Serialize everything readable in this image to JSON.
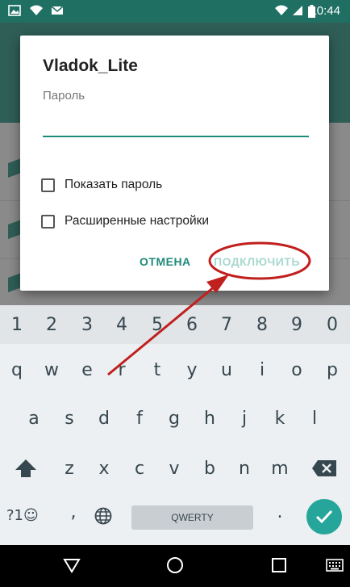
{
  "status_bar": {
    "time": "10:44"
  },
  "dialog": {
    "title": "Vladok_Lite",
    "password_label": "Пароль",
    "password_value": "",
    "show_password_label": "Показать пароль",
    "advanced_label": "Расширенные настройки",
    "cancel_label": "ОТМЕНА",
    "connect_label": "ПОДКЛЮЧИТЬ"
  },
  "keyboard": {
    "numbers": [
      "1",
      "2",
      "3",
      "4",
      "5",
      "6",
      "7",
      "8",
      "9",
      "0"
    ],
    "row1": [
      "q",
      "w",
      "e",
      "r",
      "t",
      "y",
      "u",
      "i",
      "o",
      "p"
    ],
    "row2": [
      "a",
      "s",
      "d",
      "f",
      "g",
      "h",
      "j",
      "k",
      "l"
    ],
    "row3": [
      "z",
      "x",
      "c",
      "v",
      "b",
      "n",
      "m"
    ],
    "symbols_label": "?1☺",
    "comma": ",",
    "period": ".",
    "space_label": "QWERTY"
  },
  "colors": {
    "accent": "#1e8a7a",
    "annotation": "#c0201e",
    "status_bar": "#1f6f63"
  }
}
